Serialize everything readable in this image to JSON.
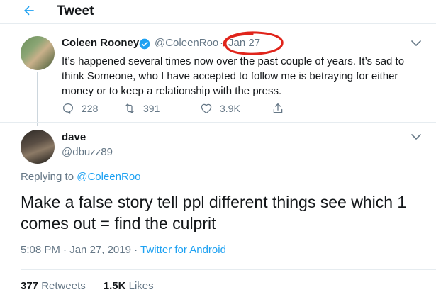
{
  "header": {
    "title": "Tweet"
  },
  "tweet": {
    "name": "Coleen Rooney",
    "handle": "@ColeenRoo",
    "separator": "·",
    "date": "Jan 27",
    "body": "It’s happened several times now over the past couple of years. It’s sad to think Someone, who I have accepted to follow me is betraying for either money or to keep a relationship with the press.",
    "replies": "228",
    "retweets": "391",
    "likes": "3.9K"
  },
  "reply": {
    "name": "dave",
    "handle": "@dbuzz89",
    "replying_prefix": "Replying to ",
    "replying_to": "@ColeenRoo",
    "body": "Make a false story tell ppl different things see which 1 comes out = find the culprit",
    "time": "5:08 PM",
    "date": "Jan 27, 2019",
    "dot": "·",
    "source": "Twitter for Android",
    "retweet_count": "377",
    "retweet_label": "Retweets",
    "like_count": "1.5K",
    "like_label": "Likes"
  },
  "colors": {
    "accent": "#1da1f2",
    "muted": "#657786",
    "annotation": "#e0241b"
  },
  "icons": [
    "back-arrow-icon",
    "verified-icon",
    "reply-icon",
    "retweet-icon",
    "like-icon",
    "share-icon",
    "chevron-down-icon"
  ]
}
